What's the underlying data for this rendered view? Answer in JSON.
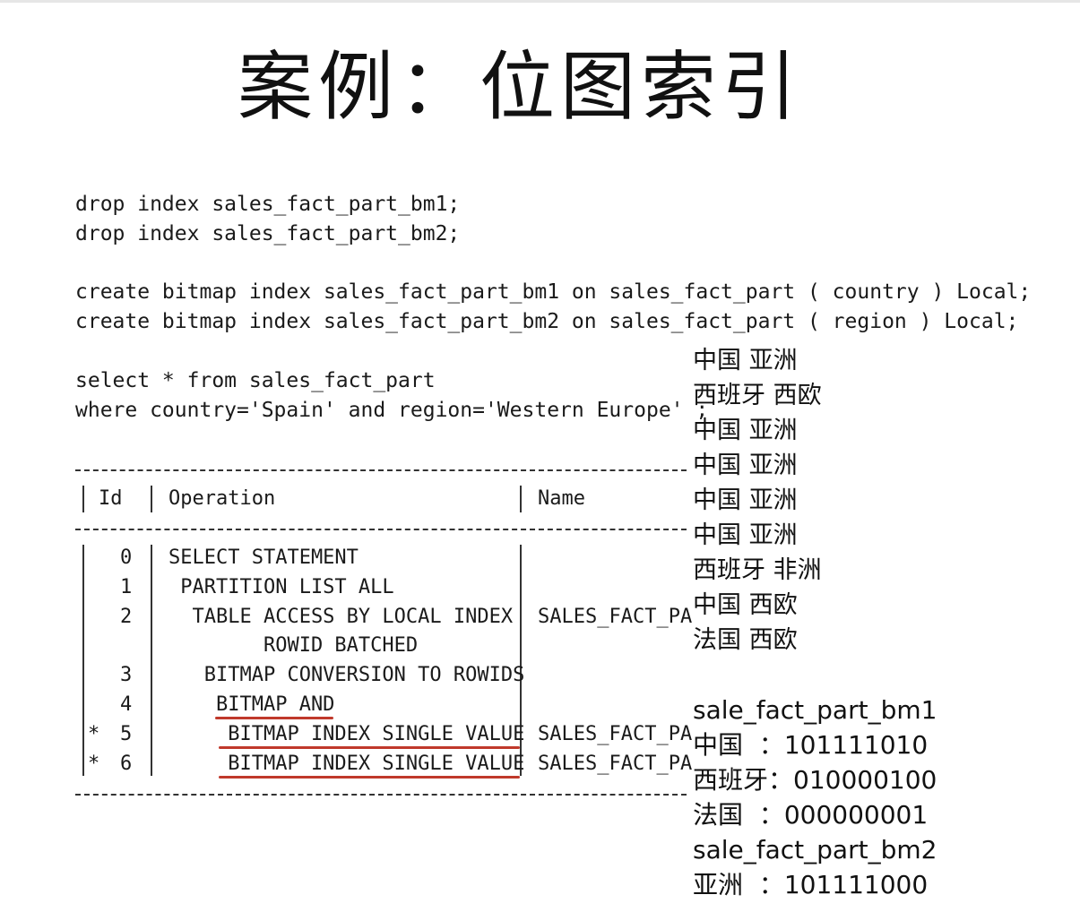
{
  "title": "案例：位图索引",
  "sql": {
    "drop1": "drop index sales_fact_part_bm1;",
    "drop2": "drop index sales_fact_part_bm2;",
    "create1": "create bitmap index sales_fact_part_bm1 on sales_fact_part ( country ) Local;",
    "create2": "create bitmap index sales_fact_part_bm2 on sales_fact_part ( region ) Local;",
    "select1": "select * from sales_fact_part",
    "select2": "where country='Spain' and region='Western Europe' ;"
  },
  "plan": {
    "headers": {
      "id": "Id",
      "operation": "Operation",
      "name": "Name"
    },
    "rows": [
      {
        "mark": "",
        "id": "0",
        "op": "SELECT STATEMENT",
        "name": ""
      },
      {
        "mark": "",
        "id": "1",
        "op": " PARTITION LIST ALL",
        "name": ""
      },
      {
        "mark": "",
        "id": "2",
        "op": "  TABLE ACCESS BY LOCAL INDEX",
        "name": "SALES_FACT_PA"
      },
      {
        "mark": "",
        "id": "",
        "op": "        ROWID BATCHED",
        "name": ""
      },
      {
        "mark": "",
        "id": "3",
        "op": "   BITMAP CONVERSION TO ROWIDS",
        "name": ""
      },
      {
        "mark": "",
        "id": "4",
        "op": "    BITMAP AND",
        "name": ""
      },
      {
        "mark": "*",
        "id": "5",
        "op": "     BITMAP INDEX SINGLE VALUE",
        "name": "SALES_FACT_PA"
      },
      {
        "mark": "*",
        "id": "6",
        "op": "     BITMAP INDEX SINGLE VALUE",
        "name": "SALES_FACT_PA"
      }
    ]
  },
  "rows_data": [
    "中国 亚洲",
    "西班牙 西欧",
    "中国 亚洲",
    "中国 亚洲",
    "中国 亚洲",
    "中国 亚洲",
    "西班牙 非洲",
    "中国 西欧",
    "法国 西欧"
  ],
  "bitmaps": {
    "bm1_title": "sale_fact_part_bm1",
    "bm1": [
      {
        "key": "中国  ：",
        "bits": "101111010"
      },
      {
        "key": "西班牙：",
        "bits": "010000100"
      },
      {
        "key": "法国  ：",
        "bits": "000000001"
      }
    ],
    "bm2_title": "sale_fact_part_bm2",
    "bm2": [
      {
        "key": "亚洲  ：",
        "bits": "101111000"
      }
    ]
  },
  "colors": {
    "underline": "#c0392b",
    "text": "#111111"
  }
}
